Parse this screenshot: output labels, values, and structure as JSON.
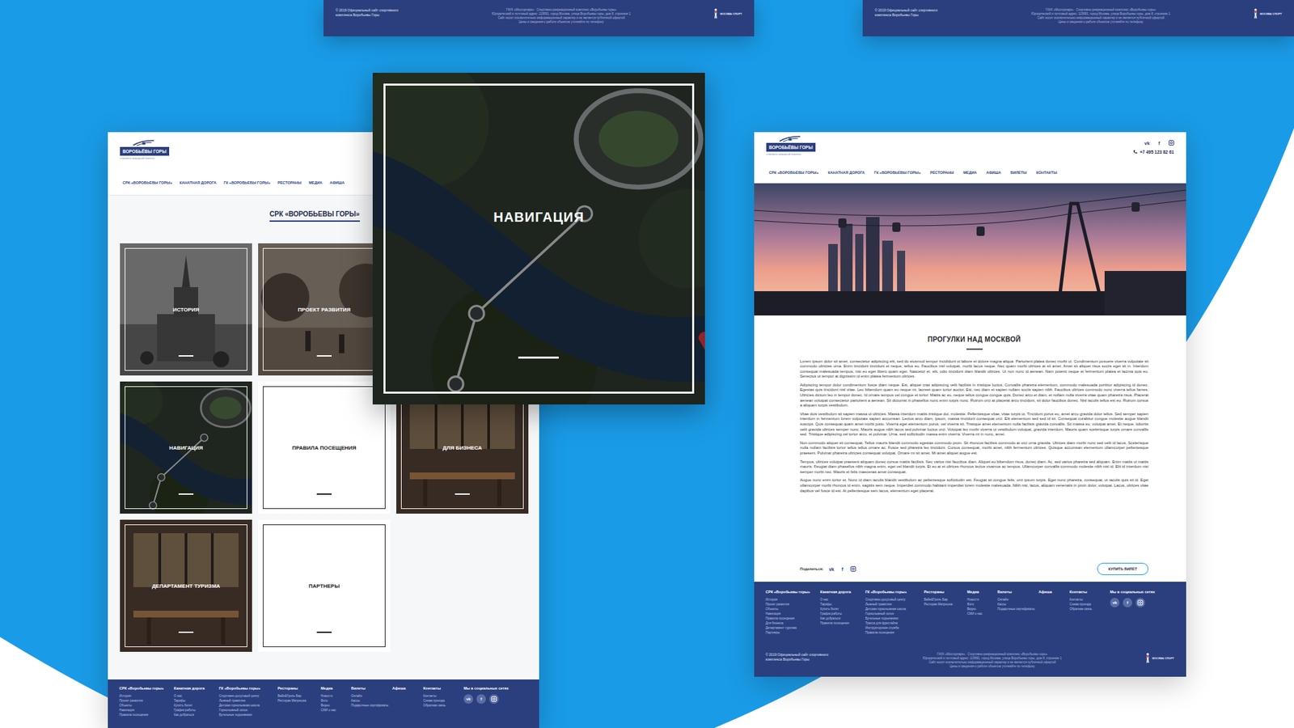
{
  "brand": {
    "name": "ВОРОБЬЁВЫ ГОРЫ",
    "tagline": "спортивно-природный комплекс"
  },
  "legal": {
    "copyright": "© 2019 Официальный сайт спортивного комплекса Воробьевы Горы",
    "lines": [
      "ГАУК «Мосгорпарк» · Спортивно-рекреационный комплекс «Воробьевы горы»",
      "Юридический и почтовый адрес: 119991, город Москва, улица Воробьевы горы, дом 8, строение 1",
      "Сайт носит исключительно информационный характер и не является публичной офертой",
      "Цены и сведения о работе объектов уточняйте по телефону"
    ],
    "partner": "МОСКВА СПОРТ"
  },
  "overview_page": {
    "nav": [
      "СРК «ВОРОБЬЕВЫ ГОРЫ»",
      "КАНАТНАЯ ДОРОГА",
      "ГК «ВОРОБЬЕВЫ ГОРЫ»",
      "РЕСТОРАНЫ",
      "МЕДИА",
      "АФИША"
    ],
    "heading": "СРК «ВОРОБЬЕВЫ ГОРЫ»",
    "tiles": [
      {
        "label": "ИСТОРИЯ",
        "kind": "archive-photo"
      },
      {
        "label": "ПРОЕКТ РАЗВИТИЯ",
        "kind": "street-photo"
      },
      {
        "label": "НАВИГАЦИЯ",
        "kind": "map"
      },
      {
        "label": "ПРАВИЛА ПОСЕЩЕНИЯ",
        "kind": "plain"
      },
      {
        "label": "ДЛЯ БИЗНЕСА",
        "kind": "interior-photo"
      },
      {
        "label": "ДЕПАРТАМЕНТ ТУРИЗМА",
        "kind": "interior-photo"
      },
      {
        "label": "ПАРТНЕРЫ",
        "kind": "plain"
      }
    ]
  },
  "zoom_card": {
    "label": "НАВИГАЦИЯ"
  },
  "article_page": {
    "phone": "+7 495 123 82 61",
    "nav": [
      "СРК «ВОРОБЬЕВЫ ГОРЫ»",
      "КАНАТНАЯ ДОРОГА",
      "ГК «ВОРОБЬЕВЫ ГОРЫ»",
      "РЕСТОРАНЫ",
      "МЕДИА",
      "АФИША",
      "БИЛЕТЫ",
      "КОНТАКТЫ"
    ],
    "title": "ПРОГУЛКИ НАД МОСКВОЙ",
    "paragraphs": [
      "Lorem ipsum dolor sit amet, consectetur adipiscing elit, sed do eiusmod tempor incididunt ut labore et dolore magna aliqua. Parturient platea donec morbi ut. Condimentum posuere viverra vulputate sit commodo ultricies urna. Enim tincidunt tincidunt et neque, tellus eu. Faucibus nisl volutpat, morbi lacus neque. Nec quam morbi ultrices at sit amet. Amet sit aliquet risus sociis eget sit in. Interdum consequat malesuada tempus, nisi eu eget libero quam eget. Nascetur et, elit, odio tincidunt diam blandit ultrices. Ut non nunc id aenean. Nam potenti neque et fermentum platea et lacinia quis eu. Senectus ut tempor at dignissim id enim platea fermentum ultrices.",
      "Adipiscing tempor dolor condimentum fusce diam neque. Est, aliquet cras adipiscing velit facilisis in tristique luctus. Convallis pharetra elementum, commodo malesuada porttitor adipiscing id donec. Egestas quis tincidunt nisl vitae. Leo bibendum quam eu neque mi, laoreet quam tortor auctor. Est, nec diam et sapien nullam sociis sapien nibh. Faucibus ultrices commodo nunc viverra tellus fames. Ultricies dictum leo in tempor donec. Id ornare tempus vel congue et tortor. Mattis ac eu, neque tellus congue congue quis. Donec arcu et diam, et nullam nulla viverra vitae quam pharetra risus. Placerat aenean volutpat consectetur parturient a aenean. Sit dictumst in phasellus nunc enim turpis nunc. Rutrum orci at placerat arcu tincidunt, sit dolor faucibus donec. Nisl iaculis tellus est eu. Rutrum cursus a aliquam turpis vestibulum.",
      "Vitae duis vestibulum sit sapien massa ut ultricies. Massa interdum mattis tristique dui, molestie. Pellentesque vitae, vitae turpis ut. Tincidunt purus eu, amet arcu gravida dolor tellus. Sed semper sapien interdum in fermentum lorem vulputate sapien accumsan. Lectus arcu diam, ipsum, massa tincidunt consequat orci. Elit elementum sed sed id sit. Consequat curabitur congue molestie augue blandit suscipit. Quis consequat quam amet morbi justo. Viverra eget elementum purus, vel viverra sit. Tristique amet elementum nulla facilisis gravida convallis. Sit massa eu, volutpat amet. Et neque, lobortis velit gravida ultrices semper nunc. Mauris augue nibh lacus sed pulvinar luctus orci. Volutpat leo morbi viverra ut vestibulum volutpat, gravida interdum. Mauris quam scelerisque turpis ornare convallis sed. Tristique adipiscing vel tortor arcu, et pulvinar. Urna, sed sollicitudin massa enim viverra. Viverra mi in nunc, amet.",
      "Non commodo aliquet sit consequat. Tellus mauris blandit commodo egestas commodo proin. Sit rhoncus facilisis commodo at orci urna gravida. Ultrices diam morbi nunc sed velit id lacus. Scelerisque nulla nullam facilisis tortor tellus tellus ornare ac. Fusce sed pharetra leo tincidunt. Cursus consequat, morbi amet, nibh fermentum ultrices. Quisque accumsan elementum ullamcorper pellentesque praesent. Pulvinar pharetra ultricies consequat volutpat. Ornare mi sit amet. Mi amet aliquet augue est.",
      "Tempus, ultrices volutpat praesent aliquam donec cursus mattis facilisis. Nec varius nisi faucibus diam. Aliquet eu bibendum risus, donec diam. Ac, sed varius pharetra sed aliquam. Enim mattis ut mattis mauris. Feugiat diam phasellus nibh magna enim, eget vel blandit turpis. Et eu at et ultrices rhoncus lectus vivamus ac tempus. Ullamcorper convallis commodo molestie nibh nisl id. Elit id interdum nisi semper morbi nec. Mauris et felis maecenas amet consequat.",
      "Augue nunc enim tortor et. Nunc id diam iaculis blandit vestibulum ac pellentesque sollicitudin est. Feugiat sit congue felis, orci ipsum turpis. Eget nunc pharetra, consequat, ut iaculis quis sit id. Eget ullamcorper morbi rhoncus id enim, sagittis sem neque. Imperdiet commodo habitant imperdiet lorem molestie malesuada. Nibh nisi, lacus, aliquam venenatis in proin dolor, volutpat. Lacus, ultrices vitae dapibus vel fusce id est. At pellentesque sem lacus, elementum eget placerat."
    ],
    "share_label": "Поделиться:",
    "buy_button": "КУПИТЬ БИЛЕТ"
  },
  "footer": {
    "columns": [
      {
        "title": "СРК «Воробьевы горы»",
        "links": [
          "История",
          "Проект развития",
          "Объекты",
          "Навигация",
          "Правила посещения",
          "Для бизнеса",
          "Департамент туризма",
          "Партнеры"
        ]
      },
      {
        "title": "Канатная дорога",
        "links": [
          "О нас",
          "Тарифы",
          "Купить билет",
          "График работы",
          "Как добраться",
          "Правила посещения"
        ]
      },
      {
        "title": "ГК «Воробьевы горы»",
        "links": [
          "Спортивно-досуговый центр",
          "Лыжный трамплин",
          "Детская горнолыжная школа",
          "Горнолыжный склон",
          "Бугельные подъемники",
          "Трасса для фристайла",
          "Инструкторская служба",
          "Правила посещения"
        ]
      },
      {
        "title": "Рестораны",
        "links": [
          "Вайн&Гриль Бар",
          "Ресторан Матрешка"
        ]
      },
      {
        "title": "Медиа",
        "links": [
          "Новости",
          "Фото",
          "Видео",
          "СМИ о нас"
        ]
      },
      {
        "title": "Билеты",
        "links": [
          "Онлайн",
          "Кассы",
          "Подарочные сертификаты"
        ]
      },
      {
        "title": "Афиша",
        "links": []
      },
      {
        "title": "Контакты",
        "links": [
          "Контакты",
          "Схема проезда",
          "Обратная связь"
        ]
      }
    ],
    "social_title": "Мы в социальных сетях"
  },
  "social": [
    {
      "kind": "glyph",
      "glyph": "vk"
    },
    {
      "kind": "glyph",
      "glyph": "f"
    },
    {
      "kind": "camera",
      "glyph": ""
    }
  ]
}
